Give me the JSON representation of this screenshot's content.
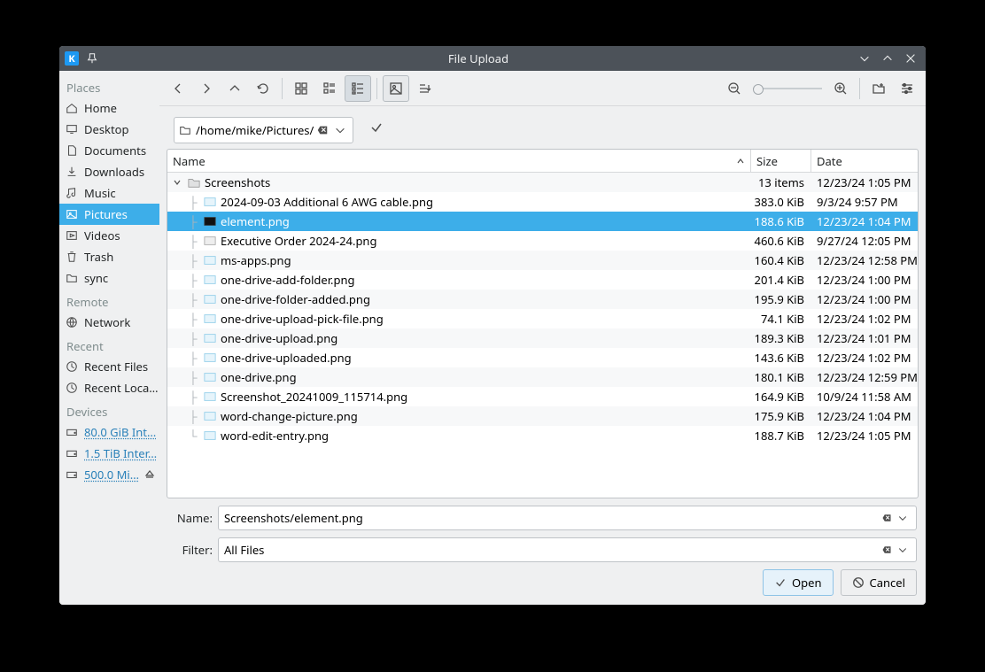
{
  "title": "File Upload",
  "sidebar": {
    "sections": [
      {
        "label": "Places",
        "items": [
          {
            "icon": "home",
            "label": "Home"
          },
          {
            "icon": "desktop",
            "label": "Desktop"
          },
          {
            "icon": "documents",
            "label": "Documents"
          },
          {
            "icon": "downloads",
            "label": "Downloads"
          },
          {
            "icon": "music",
            "label": "Music"
          },
          {
            "icon": "pictures",
            "label": "Pictures",
            "active": true
          },
          {
            "icon": "videos",
            "label": "Videos"
          },
          {
            "icon": "trash",
            "label": "Trash"
          },
          {
            "icon": "folder",
            "label": "sync"
          }
        ]
      },
      {
        "label": "Remote",
        "items": [
          {
            "icon": "network",
            "label": "Network"
          }
        ]
      },
      {
        "label": "Recent",
        "items": [
          {
            "icon": "recent",
            "label": "Recent Files"
          },
          {
            "icon": "recent",
            "label": "Recent Loca…"
          }
        ]
      },
      {
        "label": "Devices",
        "items": [
          {
            "icon": "drive",
            "label": "80.0 GiB Int…",
            "underlined": true
          },
          {
            "icon": "drive",
            "label": "1.5 TiB Inter…",
            "underlined": true,
            "eject": true
          },
          {
            "icon": "drive",
            "label": "500.0 Mi…",
            "underlined": true,
            "eject": true
          }
        ]
      }
    ]
  },
  "path": "/home/mike/Pictures/",
  "columns": {
    "name": "Name",
    "size": "Size",
    "date": "Date"
  },
  "folder": {
    "name": "Screenshots",
    "count_label": "13 items",
    "date": "12/23/24 1:05 PM"
  },
  "files": [
    {
      "name": "2024-09-03 Additional 6 AWG cable.png",
      "size": "383.0 KiB",
      "date": "9/3/24 9:57 PM",
      "thumb": "img"
    },
    {
      "name": "element.png",
      "size": "188.6 KiB",
      "date": "12/23/24 1:04 PM",
      "thumb": "dark",
      "selected": true
    },
    {
      "name": "Executive Order 2024-24.png",
      "size": "460.6 KiB",
      "date": "9/27/24 12:05 PM",
      "thumb": "doc"
    },
    {
      "name": "ms-apps.png",
      "size": "160.4 KiB",
      "date": "12/23/24 12:58 PM",
      "thumb": "img"
    },
    {
      "name": "one-drive-add-folder.png",
      "size": "201.4 KiB",
      "date": "12/23/24 1:00 PM",
      "thumb": "img"
    },
    {
      "name": "one-drive-folder-added.png",
      "size": "195.9 KiB",
      "date": "12/23/24 1:00 PM",
      "thumb": "img"
    },
    {
      "name": "one-drive-upload-pick-file.png",
      "size": "74.1 KiB",
      "date": "12/23/24 1:02 PM",
      "thumb": "img"
    },
    {
      "name": "one-drive-upload.png",
      "size": "189.3 KiB",
      "date": "12/23/24 1:01 PM",
      "thumb": "img"
    },
    {
      "name": "one-drive-uploaded.png",
      "size": "143.6 KiB",
      "date": "12/23/24 1:02 PM",
      "thumb": "img"
    },
    {
      "name": "one-drive.png",
      "size": "180.1 KiB",
      "date": "12/23/24 12:59 PM",
      "thumb": "img"
    },
    {
      "name": "Screenshot_20241009_115714.png",
      "size": "164.9 KiB",
      "date": "10/9/24 11:58 AM",
      "thumb": "img"
    },
    {
      "name": "word-change-picture.png",
      "size": "175.9 KiB",
      "date": "12/23/24 1:04 PM",
      "thumb": "img"
    },
    {
      "name": "word-edit-entry.png",
      "size": "188.7 KiB",
      "date": "12/23/24 1:05 PM",
      "thumb": "img"
    }
  ],
  "name_field": {
    "label": "Name:",
    "value": "Screenshots/element.png"
  },
  "filter_field": {
    "label": "Filter:",
    "value": "All Files"
  },
  "buttons": {
    "open": "Open",
    "cancel": "Cancel"
  }
}
